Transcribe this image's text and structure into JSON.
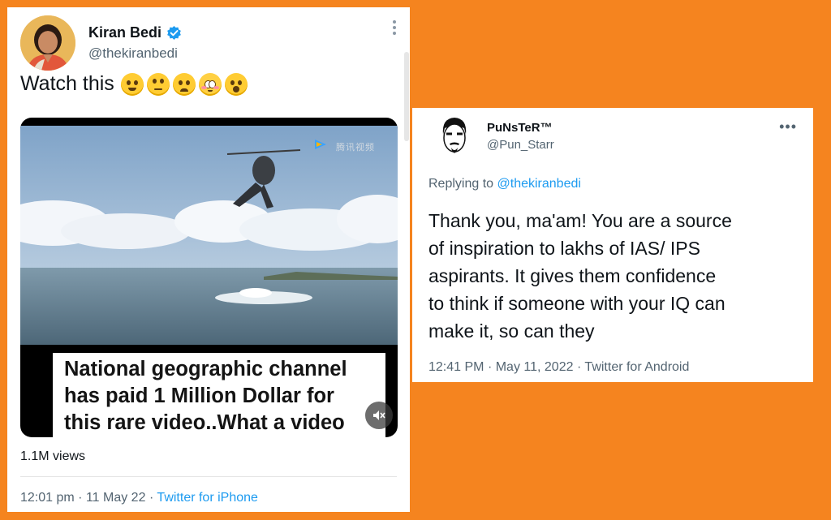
{
  "left_tweet": {
    "display_name": "Kiran Bedi",
    "handle": "@thekiranbedi",
    "text": "Watch this",
    "emojis": [
      "face-holding-back-tears",
      "face-with-rolling-eyes",
      "frowning-face",
      "flushed-face",
      "face-with-open-mouth"
    ],
    "video": {
      "watermark": "腾讯视频",
      "caption_lines": [
        "National geographic channel",
        "has paid 1 Million Dollar for",
        "this rare  video..What a video"
      ],
      "mute_icon": "muted-speaker-icon"
    },
    "views": "1.1M views",
    "time": "12:01 pm",
    "date": "11 May 22",
    "separator": "·",
    "source": "Twitter for iPhone"
  },
  "right_tweet": {
    "display_name": "PuNsTeR™",
    "handle": "@Pun_Starr",
    "more": "•••",
    "reply_prefix": "Replying to",
    "reply_mention": "@thekiranbedi",
    "body_lines": [
      "Thank you, ma'am! You are a source",
      "of inspiration to lakhs of IAS/ IPS",
      "aspirants. It gives them confidence",
      "to think if someone with your IQ can",
      "make it, so can they"
    ],
    "time": "12:41 PM",
    "date": "May 11, 2022",
    "separator": "·",
    "source": "Twitter for Android"
  },
  "colors": {
    "background": "#f5841f",
    "link": "#1d9bf0",
    "secondary_text": "#536471"
  }
}
